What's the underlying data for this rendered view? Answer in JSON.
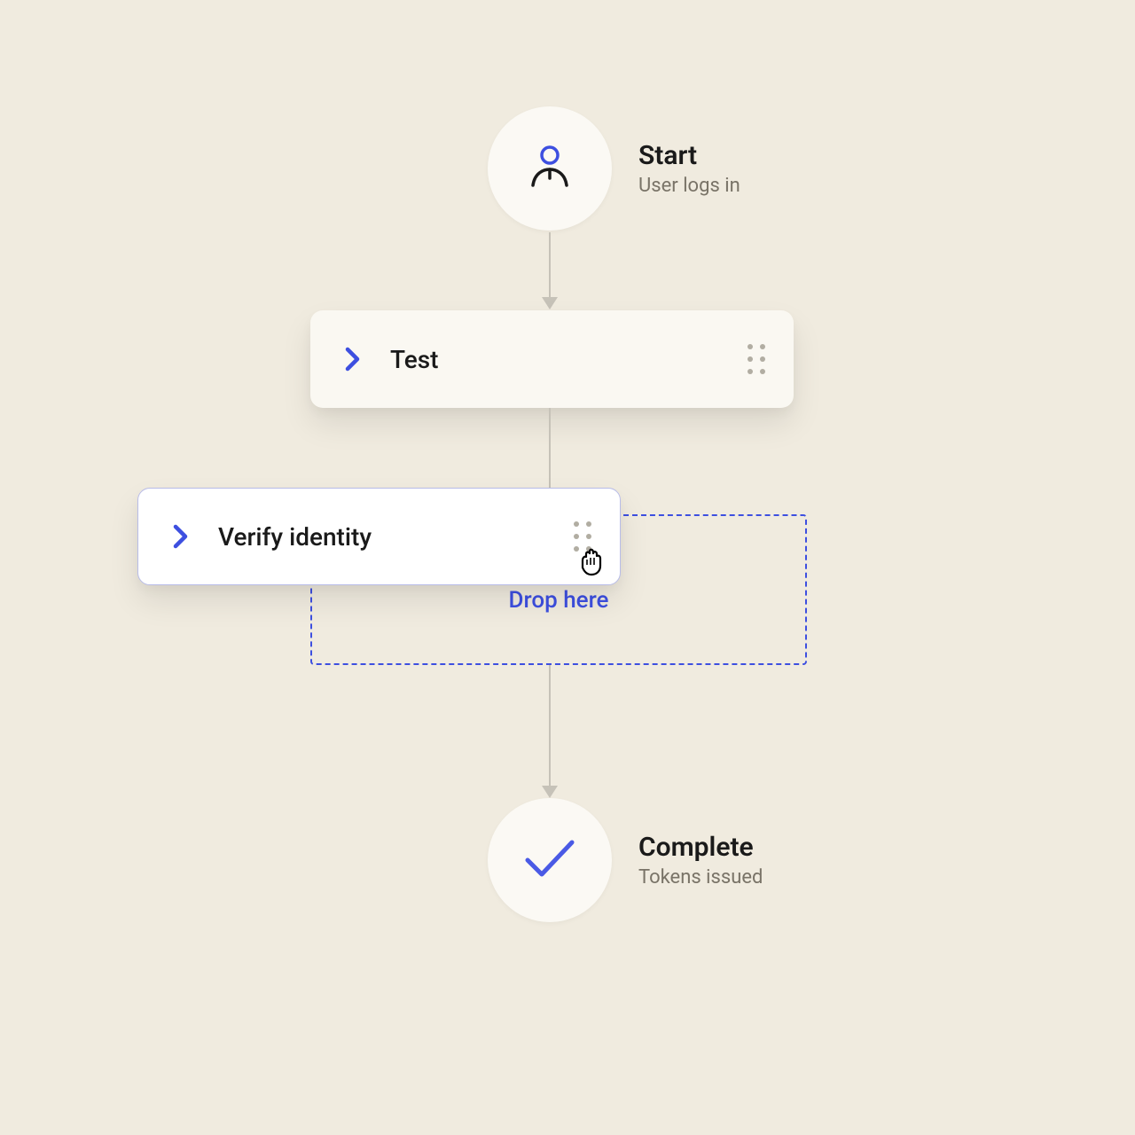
{
  "start": {
    "title": "Start",
    "subtitle": "User logs in"
  },
  "steps": [
    {
      "label": "Test"
    },
    {
      "label": "Verify identity"
    }
  ],
  "drop_zone": {
    "label": "Drop here"
  },
  "complete": {
    "title": "Complete",
    "subtitle": "Tokens issued"
  },
  "colors": {
    "accent": "#3D4FE0",
    "bg": "#F0EBDF"
  }
}
